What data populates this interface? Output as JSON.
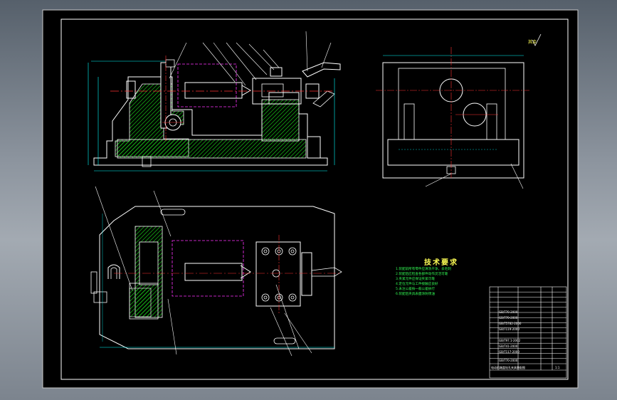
{
  "colors": {
    "background": "#000000",
    "border": "#ffffff",
    "outline": "#ffffff",
    "hatch": "#19c819",
    "centerline": "#ff3333",
    "hidden": "#ff33ff",
    "dimension": "#00ffff",
    "leader": "#ffffff",
    "notes_title": "#ffff55",
    "notes_text": "#33ff55"
  },
  "views": [
    {
      "name": "front-section-view",
      "label": "main view, sectioned"
    },
    {
      "name": "side-view",
      "label": "left view"
    },
    {
      "name": "top-view",
      "label": "top view"
    }
  ],
  "notes": {
    "title": "技术要求",
    "lines": [
      "1.装配前所有零件应清洗干净，去毛刺",
      "2.装配后应检查各部件动作灵活可靠",
      "3.夹紧元件应保证夹紧可靠",
      "4.定位元件与工件接触应良好",
      "5.未注公差按一般公差执行",
      "6.装配后夹具表面涂防锈油"
    ]
  },
  "roughness_mark": "其余",
  "title_block": {
    "rows": 15,
    "name": "电动机端盖钻孔夹具装配图",
    "codes": [
      "GB/T70-2000",
      "GB/T70-2000",
      "GB/T5782-2000",
      "GB/T119-2000",
      "GB/T97.1-2002",
      "GB/T41-2000",
      "GB/T117-2000",
      "GB/T70-2000"
    ],
    "scale": "1:1"
  }
}
